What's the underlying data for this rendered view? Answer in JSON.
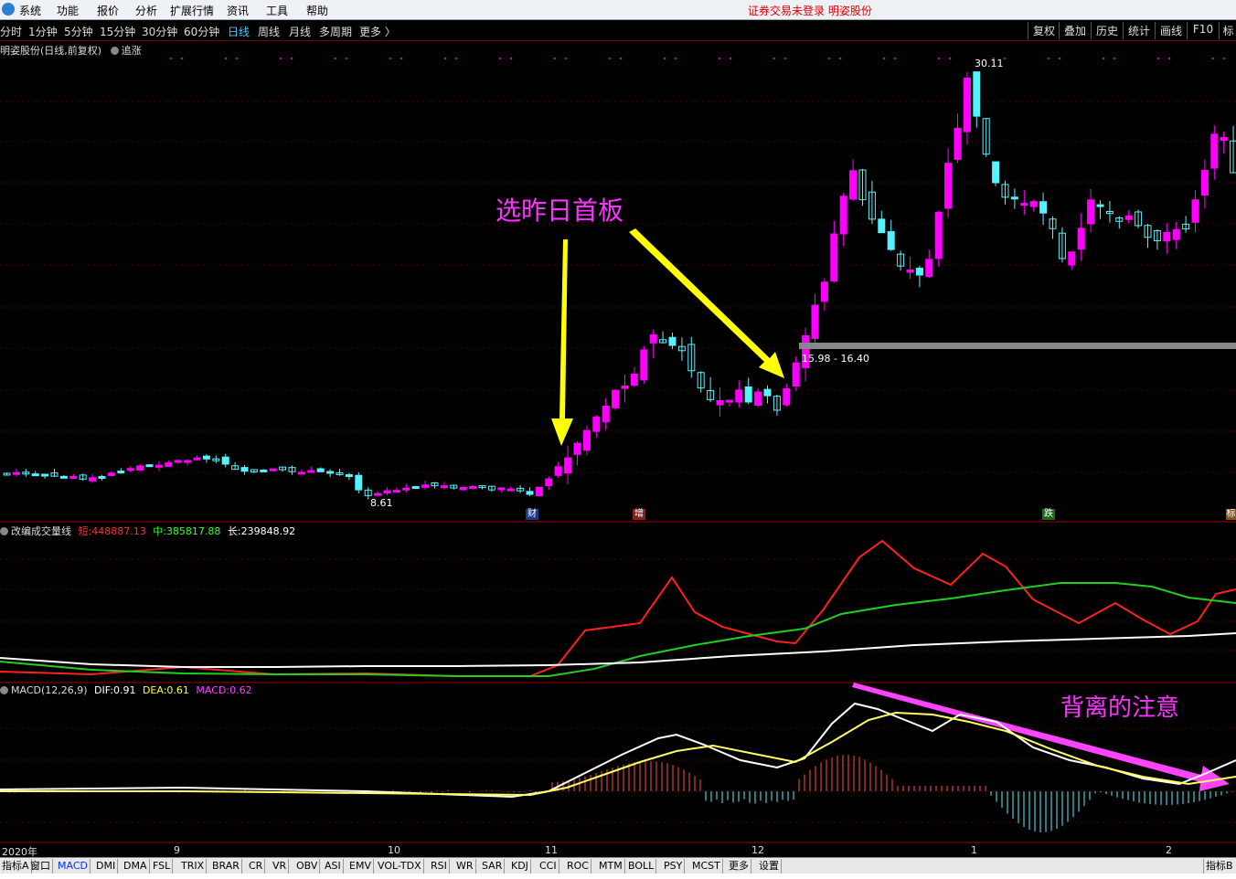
{
  "menu": [
    "系统",
    "功能",
    "报价",
    "分析",
    "扩展行情",
    "资讯",
    "工具",
    "帮助"
  ],
  "status_text": "证券交易未登录  明姿股份",
  "periods": [
    "分时",
    "1分钟",
    "5分钟",
    "15分钟",
    "30分钟",
    "60分钟",
    "日线",
    "周线",
    "月线",
    "多周期",
    "更多 〉"
  ],
  "active_period": "日线",
  "right_buttons": [
    "复权",
    "叠加",
    "历史",
    "统计",
    "画线",
    "F10",
    "标"
  ],
  "main_title": "明姿股份(日线,前复权)",
  "main_title_extra": "追涨",
  "annotations": {
    "first_board": "选昨日首板",
    "divergence": "背离的注意",
    "high_price": "30.11",
    "low_price": "8.61",
    "range_label": "15.98 - 16.40"
  },
  "event_markers": [
    "财",
    "增",
    "跌",
    "标"
  ],
  "volume_panel": {
    "name": "改编成交量线",
    "short_label": "短:",
    "short_value": "448887.13",
    "mid_label": "中:",
    "mid_value": "385817.88",
    "long_label": "长:",
    "long_value": "239848.92"
  },
  "macd_panel": {
    "name": "MACD(12,26,9)",
    "dif_label": "DIF:",
    "dif_value": "0.91",
    "dea_label": "DEA:",
    "dea_value": "0.61",
    "macd_label": "MACD:",
    "macd_value": "0.62"
  },
  "x_axis_labels": [
    "2020年",
    "9",
    "10",
    "11",
    "12",
    "1",
    "2"
  ],
  "indicator_tabs": [
    "指标A",
    "窗口",
    "MACD",
    "DMI",
    "DMA",
    "FSL",
    "TRIX",
    "BRAR",
    "CR",
    "VR",
    "OBV",
    "ASI",
    "EMV",
    "VOL-TDX",
    "RSI",
    "WR",
    "SAR",
    "KDJ",
    "CCI",
    "ROC",
    "MTM",
    "BOLL",
    "PSY",
    "MCST",
    "更多",
    "设置"
  ],
  "active_tab": "MACD",
  "right_tab": "指标B",
  "colors": {
    "up": "#ff00ff",
    "down": "#54f3ff",
    "arrow": "#ffff00",
    "divergence_arrow": "#ff44ff",
    "grid": "#600000"
  }
}
